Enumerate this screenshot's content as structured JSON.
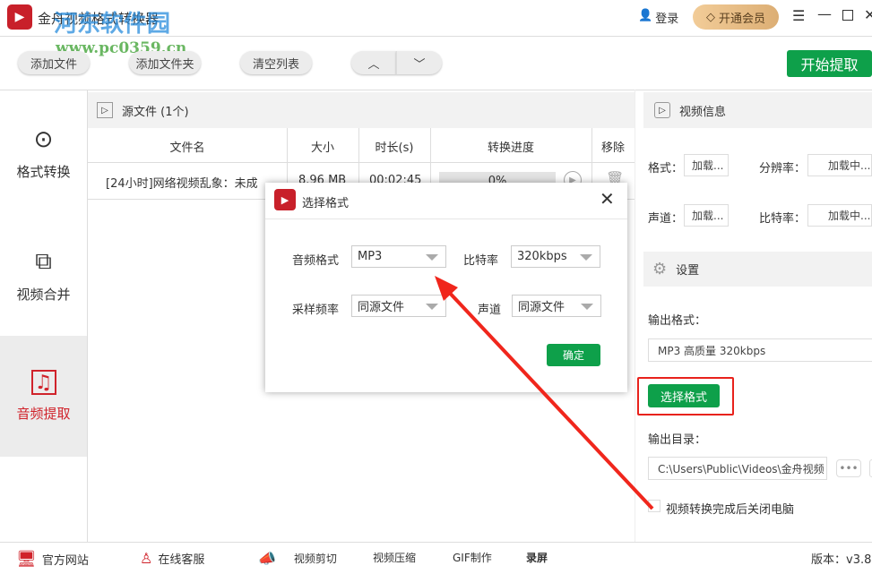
{
  "app": {
    "title": "金舟视频格式转换器",
    "login": "登录",
    "vip": "开通会员",
    "watermark": "河东软件园 www.pc0359.cn"
  },
  "toolbar": {
    "add_file": "添加文件",
    "add_folder": "添加文件夹",
    "clear": "清空列表",
    "start": "开始提取"
  },
  "sidebar": {
    "items": [
      {
        "label": "格式转换"
      },
      {
        "label": "视频合并"
      },
      {
        "label": "音频提取"
      }
    ]
  },
  "files": {
    "header": "源文件 (1个)",
    "columns": [
      "文件名",
      "大小",
      "时长(s)",
      "转换进度",
      "移除"
    ],
    "rows": [
      {
        "name": "[24小时]网络视频乱象：未成",
        "size": "8.96 MB",
        "duration": "00:02:45",
        "progress": "0%"
      }
    ]
  },
  "info": {
    "title": "视频信息",
    "format_label": "格式：",
    "format": "加载...",
    "res_label": "分辨率：",
    "res": "加载中...",
    "channel_label": "声道：",
    "channel": "加载...",
    "bitrate_label": "比特率：",
    "bitrate": "加载中..."
  },
  "settings": {
    "title": "设置",
    "out_format_label": "输出格式：",
    "out_format": "MP3 高质量 320kbps",
    "choose": "选择格式",
    "out_dir_label": "输出目录：",
    "out_dir": "C:\\Users\\Public\\Videos\\金舟视频",
    "shutdown": "视频转换完成后关闭电脑"
  },
  "dialog": {
    "title": "选择格式",
    "audio_format_label": "音频格式",
    "audio_format": "MP3",
    "bitrate_label": "比特率",
    "bitrate": "320kbps",
    "sample_label": "采样频率",
    "sample": "同源文件",
    "channel_label": "声道",
    "channel": "同源文件",
    "ok": "确定"
  },
  "footer": {
    "site": "官方网站",
    "service": "在线客服",
    "cut": "视频剪切",
    "compress": "视频压缩",
    "gif": "GIF制作",
    "record": "录屏",
    "version": "版本：v3.8"
  },
  "colors": {
    "accent": "#0ea04a",
    "brand": "#d0232b"
  }
}
